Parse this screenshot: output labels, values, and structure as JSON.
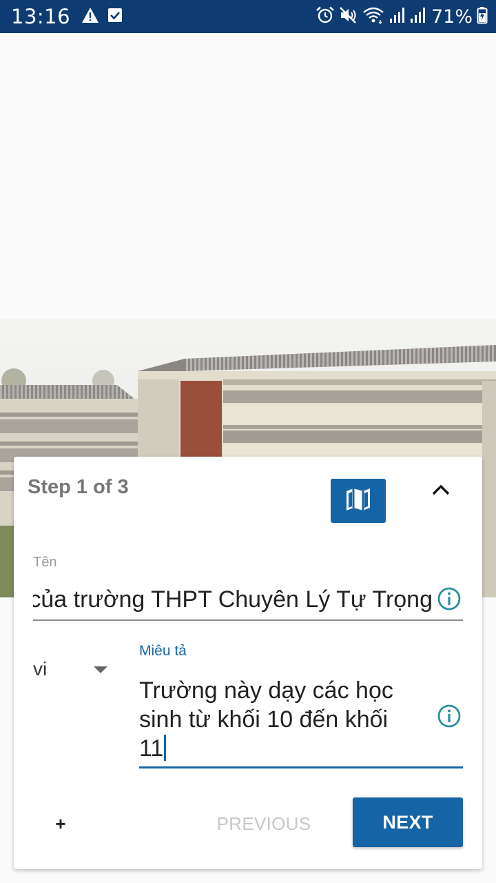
{
  "status_bar": {
    "time": "13:16",
    "battery_percent": "71%",
    "left_icons": [
      "warning-icon",
      "checkbox-icon"
    ],
    "right_icons": [
      "alarm-icon",
      "mute-icon",
      "wifi-icon",
      "signal-icon",
      "signal-icon",
      "battery-charging-icon"
    ],
    "background_color": "#0d3b72"
  },
  "photo": {
    "subject": "school-building-photo"
  },
  "wizard": {
    "step_title": "Step 1 of 3",
    "map_button_icon": "map-icon",
    "collapse_icon": "chevron-up-icon",
    "name_label": "Tên",
    "name_value": "của trường THPT Chuyên Lý Tự Trọng",
    "language_value": "vi",
    "description_label": "Miêu tả",
    "description_value": "Trường này dạy các học sinh từ khối 10 đến khối 11",
    "add_label": "+",
    "previous_label": "PREVIOUS",
    "next_label": "NEXT",
    "accent_color": "#1565a6",
    "info_icon_color": "#2a8fa0"
  }
}
